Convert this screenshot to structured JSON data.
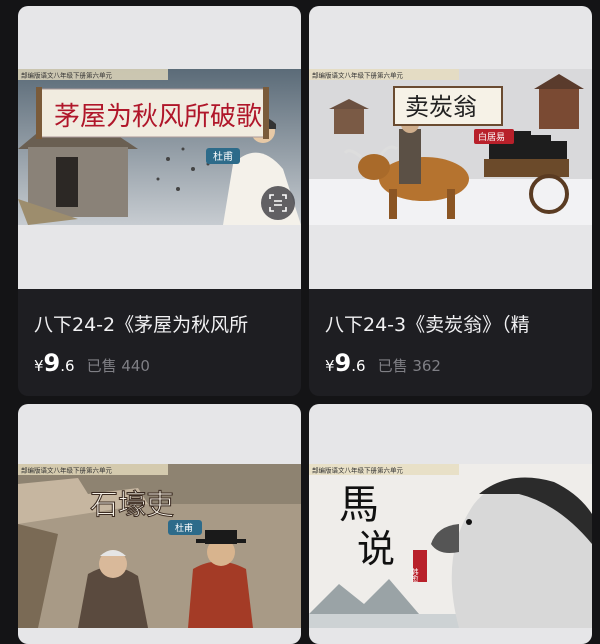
{
  "cards": [
    {
      "banner": "部编版语文八年级下册第六单元",
      "art_title": "茅屋为秋风所破歌",
      "author": "杜甫",
      "title": "八下24-2《茅屋为秋风所",
      "price_symbol": "¥",
      "price_int": "9",
      "price_dec": ".6",
      "sold": "已售 440"
    },
    {
      "banner": "部编版语文八年级下册第六单元",
      "art_title": "卖炭翁",
      "author": "白居易",
      "title": "八下24-3《卖炭翁》（精",
      "price_symbol": "¥",
      "price_int": "9",
      "price_dec": ".6",
      "sold": "已售 362"
    },
    {
      "banner": "部编版语文八年级下册第六单元",
      "art_title": "石壕吏",
      "author": "杜甫"
    },
    {
      "banner": "部编版语文八年级下册第六单元",
      "art_title_1": "馬",
      "art_title_2": "说",
      "author": "韩愈"
    }
  ],
  "icons": {
    "scan": "scan-icon"
  },
  "colors": {
    "background": "#141416",
    "card": "#1e1e22",
    "price": "#ffffff",
    "sold": "#7f7f85"
  }
}
